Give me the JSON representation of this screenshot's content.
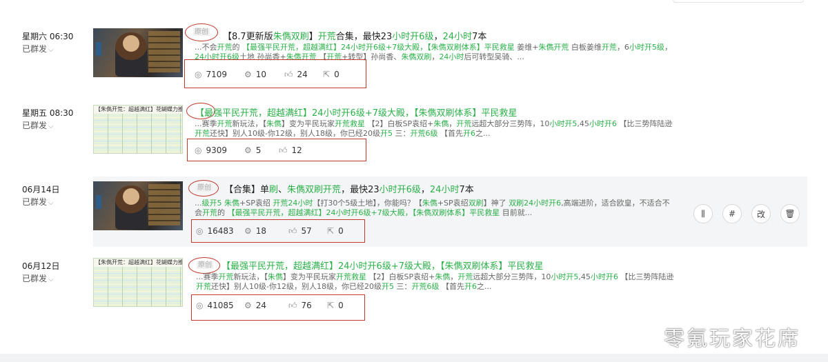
{
  "posts": [
    {
      "date": "星期六 06:30",
      "status": "已群发",
      "tag": "原创",
      "title_parts": [
        {
          "t": "【8.7更新版",
          "g": false
        },
        {
          "t": "朱儁双刷",
          "g": true
        },
        {
          "t": "】",
          "g": false
        },
        {
          "t": "开荒",
          "g": true
        },
        {
          "t": "合集，最快23",
          "g": false
        },
        {
          "t": "小时开6级",
          "g": true
        },
        {
          "t": "，",
          "g": false
        },
        {
          "t": "24小时",
          "g": true
        },
        {
          "t": "7本",
          "g": false
        }
      ],
      "excerpt_parts": [
        {
          "t": "...不会",
          "g": false
        },
        {
          "t": "开荒",
          "g": true
        },
        {
          "t": "的 ",
          "g": false
        },
        {
          "t": "【最强平民开荒，超越满红】24小时开6级+7级大殿，【朱儁双刷体系】平民救星",
          "g": true
        },
        {
          "t": " 姜维+",
          "g": false
        },
        {
          "t": "朱儁开荒",
          "g": true
        },
        {
          "t": " 白板姜维",
          "g": false
        },
        {
          "t": "开荒",
          "g": true
        },
        {
          "t": "，6",
          "g": false
        },
        {
          "t": "小时开5级",
          "g": true
        },
        {
          "t": "，",
          "g": false
        },
        {
          "t": "24小时开6级",
          "g": true
        },
        {
          "t": "土地 孙尚香+",
          "g": false
        },
        {
          "t": "朱儁开荒",
          "g": true
        },
        {
          "t": " 【",
          "g": false
        },
        {
          "t": "开荒",
          "g": true
        },
        {
          "t": "+转型】孙尚香、",
          "g": false
        },
        {
          "t": "朱儁双刷",
          "g": true
        },
        {
          "t": "，",
          "g": false
        },
        {
          "t": "24小时",
          "g": true
        },
        {
          "t": "后可转型吴骑、...",
          "g": false
        }
      ],
      "views": "7109",
      "shares": "10",
      "likes": "24",
      "reposts": "0"
    },
    {
      "date": "星期五 08:30",
      "status": "已群发",
      "thumb_header": "【朱儁开荒：超越满红】花蝴蝶力推荐",
      "title_parts": [
        {
          "t": "【最强平民开荒，超越满红】",
          "g": true
        },
        {
          "t": "24小时开6级+7级大殿",
          "g": true
        },
        {
          "t": "，【朱儁双刷体系】平民救星",
          "g": true
        }
      ],
      "excerpt_parts": [
        {
          "t": "...赛季",
          "g": false
        },
        {
          "t": "开荒",
          "g": true
        },
        {
          "t": "新玩法，【",
          "g": false
        },
        {
          "t": "朱儁",
          "g": true
        },
        {
          "t": "】变为平民玩家",
          "g": false
        },
        {
          "t": "开荒救星",
          "g": true
        },
        {
          "t": " 【2】白板SP袁绍+",
          "g": false
        },
        {
          "t": "朱儁",
          "g": true
        },
        {
          "t": "，",
          "g": false
        },
        {
          "t": "开荒",
          "g": true
        },
        {
          "t": "远超大部分三势阵，10",
          "g": false
        },
        {
          "t": "小时开5",
          "g": true
        },
        {
          "t": ",45",
          "g": false
        },
        {
          "t": "小时开6",
          "g": true
        },
        {
          "t": " 【比三势阵陆逊",
          "g": false
        },
        {
          "t": "开荒",
          "g": true
        },
        {
          "t": "还快】别人10级-你12级，别人18级，你已经20级",
          "g": false
        },
        {
          "t": "开5",
          "g": true
        },
        {
          "t": " 三：",
          "g": false
        },
        {
          "t": "开荒6级",
          "g": true
        },
        {
          "t": " 【首先",
          "g": false
        },
        {
          "t": "开6",
          "g": true
        },
        {
          "t": "之...",
          "g": false
        }
      ],
      "views": "9309",
      "shares": "5",
      "likes": "12"
    },
    {
      "date": "06月14日",
      "status": "已群发",
      "tag": "原创",
      "title_parts": [
        {
          "t": "【合集】单",
          "g": false
        },
        {
          "t": "刷",
          "g": true
        },
        {
          "t": "、",
          "g": false
        },
        {
          "t": "朱儁双刷开荒",
          "g": true
        },
        {
          "t": "，最快23",
          "g": false
        },
        {
          "t": "小时开6级",
          "g": true
        },
        {
          "t": "，",
          "g": false
        },
        {
          "t": "24小时",
          "g": true
        },
        {
          "t": "7本",
          "g": false
        }
      ],
      "excerpt_parts": [
        {
          "t": "...",
          "g": false
        },
        {
          "t": "级开5 朱儁",
          "g": true
        },
        {
          "t": "+SP袁绍 ",
          "g": false
        },
        {
          "t": "开荒24小时",
          "g": true
        },
        {
          "t": "【打30个5级土地】，你能吗？【",
          "g": false
        },
        {
          "t": "朱儁",
          "g": true
        },
        {
          "t": "+SP袁绍",
          "g": false
        },
        {
          "t": "双刷",
          "g": true
        },
        {
          "t": "】神了 ",
          "g": false
        },
        {
          "t": "双刷24小时开6",
          "g": true
        },
        {
          "t": ",高端进阶，适合欧皇，不适合不会",
          "g": false
        },
        {
          "t": "开荒",
          "g": true
        },
        {
          "t": "的 ",
          "g": false
        },
        {
          "t": "【最强平民开荒，超越满红】24小时开6级+7级大殿，【朱儁双刷体系】平民救星",
          "g": true
        },
        {
          "t": " 目前就...",
          "g": false
        }
      ],
      "views": "16483",
      "shares": "18",
      "likes": "57",
      "reposts": "0",
      "actions": [
        "stats",
        "#",
        "改",
        "delete"
      ]
    },
    {
      "date": "06月12日",
      "status": "已群发",
      "tag": "原创",
      "thumb_header": "【朱儁开荒：超越满红】花蝴蝶力推荐",
      "title_parts": [
        {
          "t": "【最强平民开荒，超越满红】",
          "g": true
        },
        {
          "t": "24小时开6级+7级大殿",
          "g": true
        },
        {
          "t": "，【朱儁双刷体系】平民救星",
          "g": true
        }
      ],
      "excerpt_parts": [
        {
          "t": "...赛季",
          "g": false
        },
        {
          "t": "开荒",
          "g": true
        },
        {
          "t": "新玩法，【",
          "g": false
        },
        {
          "t": "朱儁",
          "g": true
        },
        {
          "t": "】变为平民玩家",
          "g": false
        },
        {
          "t": "开荒救星",
          "g": true
        },
        {
          "t": " 【2】白板SP袁绍+",
          "g": false
        },
        {
          "t": "朱儁",
          "g": true
        },
        {
          "t": "，",
          "g": false
        },
        {
          "t": "开荒",
          "g": true
        },
        {
          "t": "远超大部分三势阵，10",
          "g": false
        },
        {
          "t": "小时开5",
          "g": true
        },
        {
          "t": ",45",
          "g": false
        },
        {
          "t": "小时开6",
          "g": true
        },
        {
          "t": " 【比三势阵陆逊",
          "g": false
        },
        {
          "t": "开荒",
          "g": true
        },
        {
          "t": "还快】别人10级-你12级，别人18级，你已经20级",
          "g": false
        },
        {
          "t": "开5",
          "g": true
        },
        {
          "t": " 三：",
          "g": false
        },
        {
          "t": "开荒6级",
          "g": true
        },
        {
          "t": " 【首先",
          "g": false
        },
        {
          "t": "开6",
          "g": true
        },
        {
          "t": "之...",
          "g": false
        }
      ],
      "views": "41085",
      "shares": "24",
      "likes": "76",
      "reposts": "0"
    }
  ],
  "watermark": "零氪玩家花席",
  "colors": {
    "green": "#2bb04a",
    "annotation_red": "#c0392b",
    "highlight_bg": "#f4f5f6"
  },
  "icons": {
    "views": "eye-icon",
    "shares": "gear-icon",
    "likes": "thumbs-up-icon",
    "reposts": "share-out-icon"
  }
}
